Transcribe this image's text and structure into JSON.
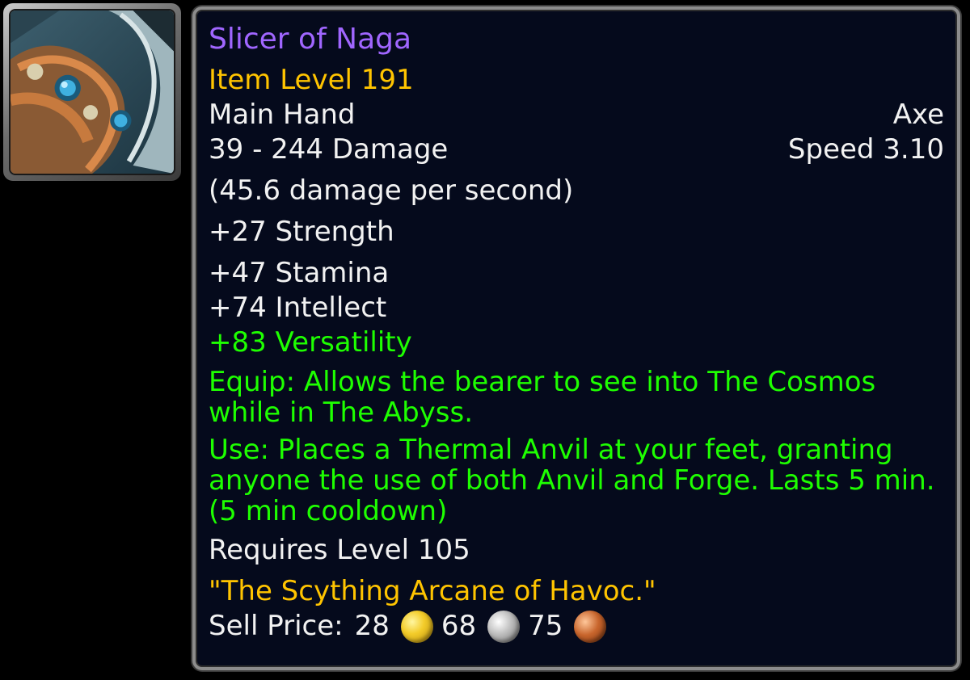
{
  "item": {
    "icon": "axe-item-icon",
    "name": "Slicer of Naga",
    "item_level": "Item Level 191",
    "slot": "Main Hand",
    "type": "Axe",
    "damage": "39 - 244 Damage",
    "speed": "Speed 3.10",
    "dps": "(45.6 damage per second)",
    "stats": {
      "strength": "+27 Strength",
      "stamina": "+47 Stamina",
      "intellect": "+74 Intellect",
      "versatility": "+83 Versatility"
    },
    "equip_effect": "Equip: Allows the bearer to see into The Cosmos while in The Abyss.",
    "use_effect": "Use: Places a Thermal Anvil at your feet, granting anyone the use of both Anvil and Forge. Lasts 5 min. (5 min cooldown)",
    "requires": "Requires Level 105",
    "flavor": "\"The Scything Arcane of Havoc.\"",
    "sell_price": {
      "label": "Sell Price:",
      "gold": "28",
      "silver": "68",
      "copper": "75"
    }
  },
  "colors": {
    "name": "#a066ff",
    "item_level": "#ffc400",
    "bonus": "#1eff00",
    "text": "#f2f2f2",
    "background": "#050a1c"
  }
}
